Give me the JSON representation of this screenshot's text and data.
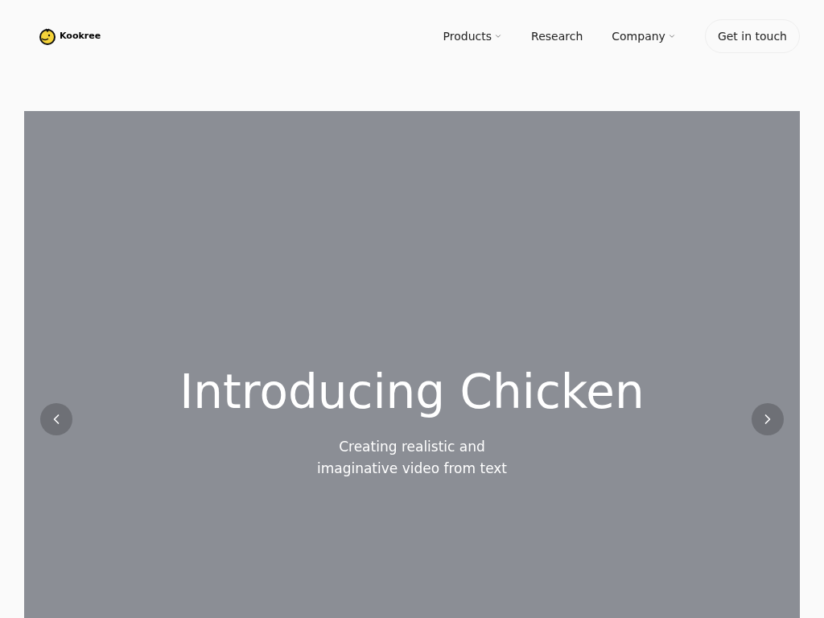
{
  "logo": {
    "name": "Kookree"
  },
  "nav": [
    {
      "label": "Products",
      "dropdown": true
    },
    {
      "label": "Research",
      "dropdown": false
    },
    {
      "label": "Company",
      "dropdown": true
    }
  ],
  "cta": {
    "label": "Get in touch"
  },
  "hero": {
    "title": "Introducing Chicken",
    "subtitle_lines": [
      "Creating realistic and",
      "imaginative video from text"
    ]
  }
}
